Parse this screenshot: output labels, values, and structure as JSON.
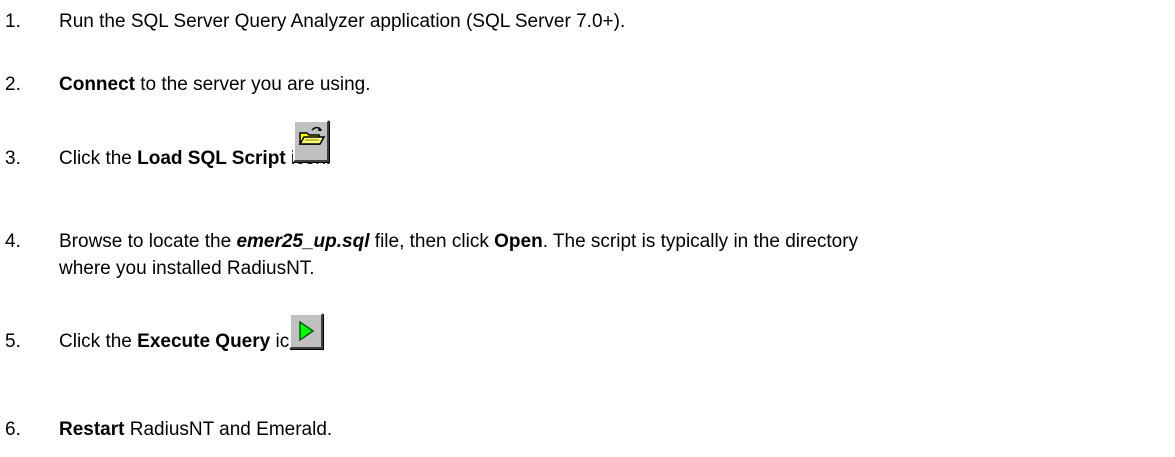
{
  "steps": [
    {
      "number": "1.",
      "text": "Run the SQL Server Query Analyzer application (SQL Server 7.0+)."
    },
    {
      "number": "2.",
      "bold": "Connect",
      "rest": " to the server you are using."
    },
    {
      "number": "3.",
      "pre": "Click the ",
      "bold": "Load SQL Script",
      "post": " icon.",
      "icon": "open-folder-icon"
    },
    {
      "number": "4.",
      "pre": "Browse to locate the ",
      "bold_italic": "emer25_up.sql",
      "mid": " file, then click ",
      "bold": "Open",
      "post": ". The script is typically in the directory",
      "line2": "where you installed RadiusNT."
    },
    {
      "number": "5.",
      "pre": "Click the ",
      "bold": "Execute Query",
      "post": " icon.",
      "icon": "execute-play-icon"
    },
    {
      "number": "6.",
      "bold": "Restart",
      "rest": " RadiusNT and Emerald."
    }
  ],
  "colors": {
    "text": "#000000",
    "background": "#ffffff",
    "button_face": "#c0c0c0",
    "folder_yellow": "#ffff00",
    "play_green": "#00ff00"
  }
}
